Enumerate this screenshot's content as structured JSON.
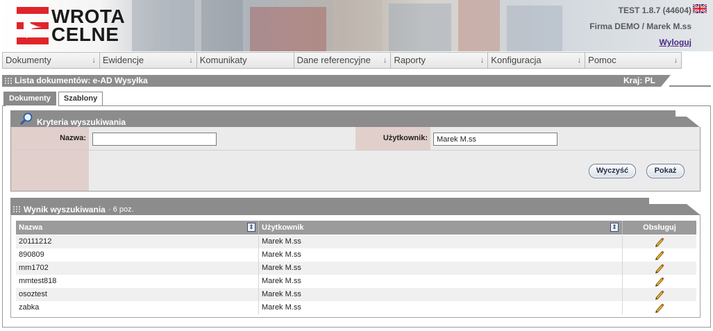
{
  "header": {
    "logo_line1": "WROTA",
    "logo_line2": "CELNE",
    "version": "TEST  1.8.7 (44604)",
    "company": "Firma DEMO / Marek M.ss",
    "logout": "Wyloguj",
    "language_icon": "uk-flag-icon"
  },
  "menu": [
    {
      "label": "Dokumenty",
      "arrow": "↓"
    },
    {
      "label": "Ewidencje",
      "arrow": "↓"
    },
    {
      "label": "Komunikaty",
      "arrow": ""
    },
    {
      "label": "Dane referencyjne",
      "arrow": "↓"
    },
    {
      "label": "Raporty",
      "arrow": "↓"
    },
    {
      "label": "Konfiguracja",
      "arrow": "↓"
    },
    {
      "label": "Pomoc",
      "arrow": "↓"
    }
  ],
  "panel": {
    "title": "Lista dokumentów:  e-AD Wysyłka",
    "country": "Kraj: PL"
  },
  "tabs": [
    {
      "label": "Dokumenty",
      "active": false
    },
    {
      "label": "Szablony",
      "active": true
    }
  ],
  "criteria": {
    "title": "Kryteria wyszukiwania",
    "name_label": "Nazwa:",
    "name_value": "",
    "user_label": "Użytkownik:",
    "user_value": "Marek M.ss",
    "clear_button": "Wyczyść",
    "show_button": "Pokaż"
  },
  "results": {
    "title": "Wynik wyszukiwania",
    "count": "· 6 poz.",
    "columns": [
      "Nazwa",
      "Użytkownik",
      "Obsługuj"
    ],
    "rows": [
      {
        "name": "20111212",
        "user": "Marek M.ss"
      },
      {
        "name": "890809",
        "user": "Marek M.ss"
      },
      {
        "name": "mm1702",
        "user": "Marek M.ss"
      },
      {
        "name": "mmtest818",
        "user": "Marek M.ss"
      },
      {
        "name": "osoztest",
        "user": "Marek M.ss"
      },
      {
        "name": "zabka",
        "user": "Marek M.ss"
      }
    ]
  },
  "colors": {
    "accent_red": "#e0252a",
    "header_gray": "#8c8c8c",
    "label_pink": "#e1cfcb",
    "logout_link": "#4b2a86"
  }
}
